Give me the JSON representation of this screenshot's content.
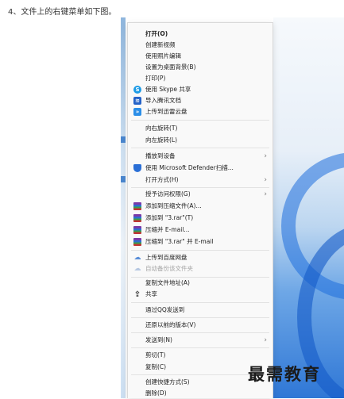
{
  "instruction": "4、文件上的右键菜单如下图。",
  "watermark": "最需教育",
  "menu": {
    "items": [
      {
        "label": "打开(O)",
        "icon": "none"
      },
      {
        "label": "创建新视频",
        "icon": "none"
      },
      {
        "label": "使用照片编辑",
        "icon": "none"
      },
      {
        "label": "设置为桌面背景(B)",
        "icon": "none"
      },
      {
        "label": "打印(P)",
        "icon": "none"
      },
      {
        "label": "使用 Skype 共享",
        "icon": "skype-icon"
      },
      {
        "label": "导入腾讯文档",
        "icon": "tencent-docs-icon"
      },
      {
        "label": "上传到迅雷云盘",
        "icon": "xunlei-icon"
      },
      {
        "label": "向右旋转(T)",
        "icon": "none"
      },
      {
        "label": "向左旋转(L)",
        "icon": "none"
      },
      {
        "label": "播放到设备",
        "icon": "none",
        "submenu": true
      },
      {
        "label": "使用 Microsoft Defender扫描...",
        "icon": "defender-shield-icon"
      },
      {
        "label": "打开方式(H)",
        "icon": "none",
        "submenu": true
      },
      {
        "label": "授予访问权限(G)",
        "icon": "none",
        "submenu": true
      },
      {
        "label": "添加到压缩文件(A)...",
        "icon": "winrar-icon"
      },
      {
        "label": "添加到 \"3.rar\"(T)",
        "icon": "winrar-icon"
      },
      {
        "label": "压缩并 E-mail...",
        "icon": "winrar-icon"
      },
      {
        "label": "压缩到 \"3.rar\" 并 E-mail",
        "icon": "winrar-icon"
      },
      {
        "label": "上传到百度网盘",
        "icon": "baidu-cloud-icon"
      },
      {
        "label": "自动备份该文件夹",
        "icon": "baidu-cloud-icon",
        "disabled": true
      },
      {
        "label": "复制文件地址(A)",
        "icon": "none"
      },
      {
        "label": "共享",
        "icon": "share-icon"
      },
      {
        "label": "通过QQ发送到",
        "icon": "none"
      },
      {
        "label": "还原以前的版本(V)",
        "icon": "none"
      },
      {
        "label": "发送到(N)",
        "icon": "none",
        "submenu": true
      },
      {
        "label": "剪切(T)",
        "icon": "none"
      },
      {
        "label": "复制(C)",
        "icon": "none"
      },
      {
        "label": "创建快捷方式(S)",
        "icon": "none"
      },
      {
        "label": "删除(D)",
        "icon": "none"
      }
    ]
  },
  "colors": {
    "menu_background": "#f9f9f9",
    "separator": "#e2e2e2",
    "disabled_text": "#a5a5a5",
    "desktop_accent": "#2f77d6"
  }
}
